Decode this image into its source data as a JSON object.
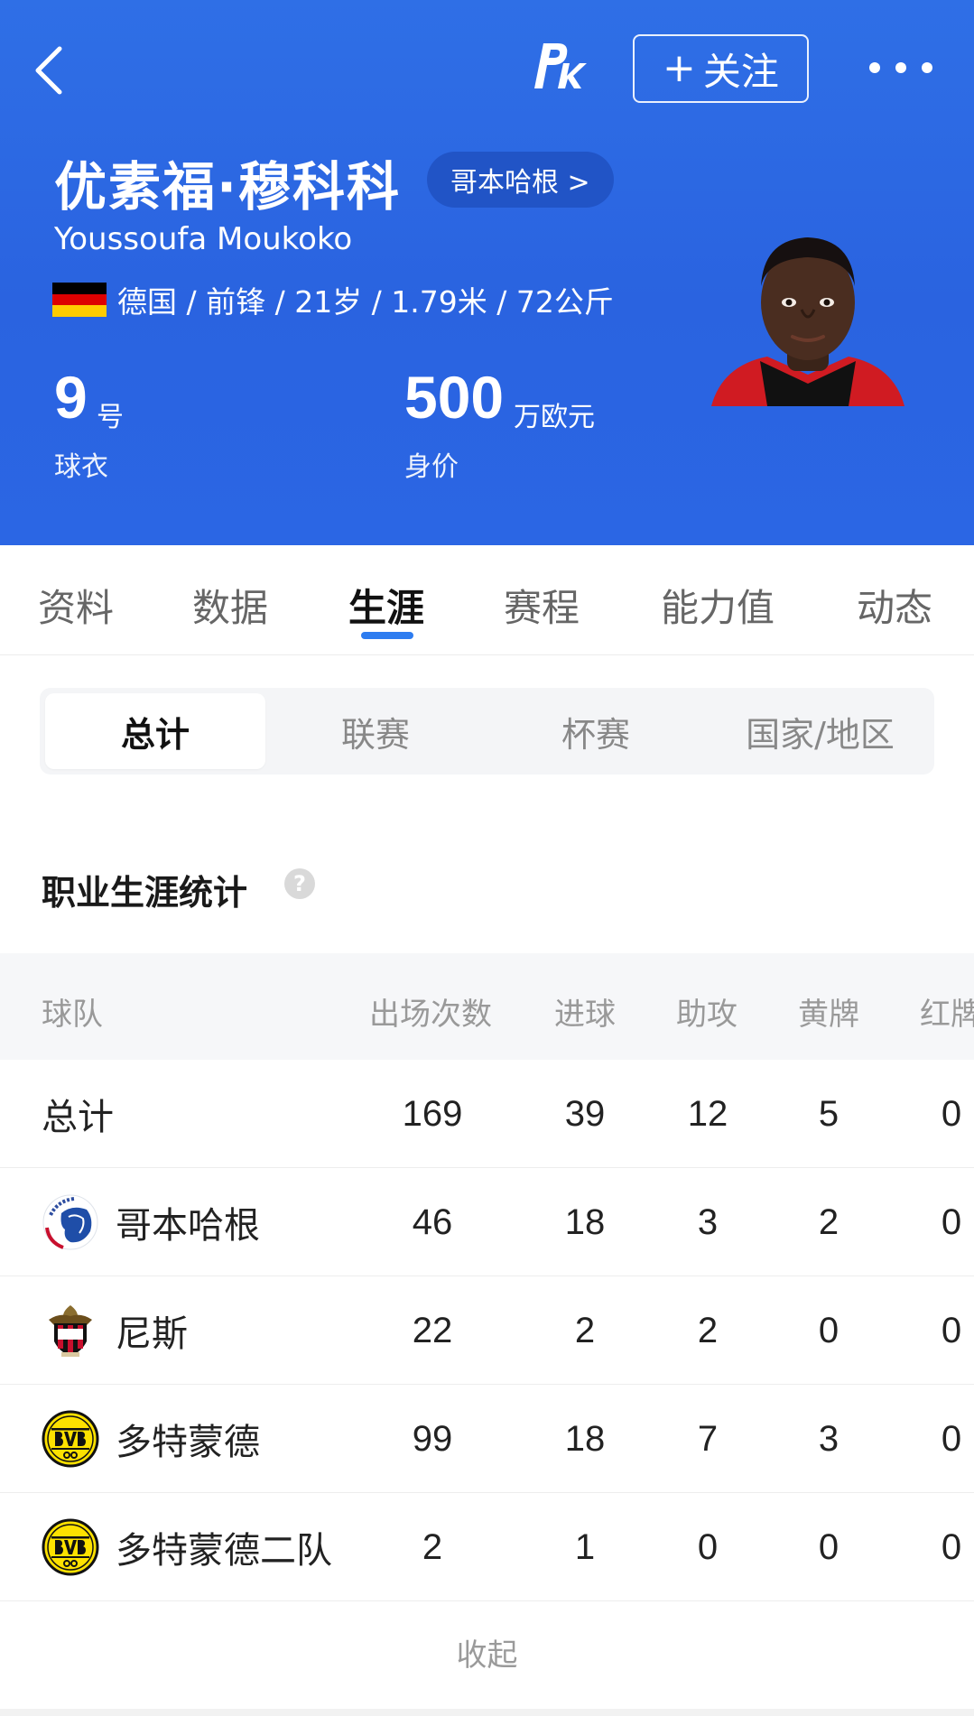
{
  "header": {
    "follow_label": "关注",
    "follow_plus": "+",
    "logo_text": "PK",
    "name_cn": "优素福·穆科科",
    "club_pill": "哥本哈根 >",
    "name_en": "Youssoufa Moukoko",
    "info_line": "德国 / 前锋 / 21岁 / 1.79米 / 72公斤",
    "flag_colors": [
      "#000000",
      "#dd0000",
      "#ffcc00"
    ],
    "jersey": {
      "value": "9",
      "unit": "号",
      "label": "球衣"
    },
    "market_value": {
      "value": "500",
      "unit": "万欧元",
      "label": "身价"
    },
    "colors": {
      "background": "#2a63e0",
      "pill": "#2154c6"
    }
  },
  "tabs": {
    "items": [
      "资料",
      "数据",
      "生涯",
      "赛程",
      "能力值",
      "动态"
    ],
    "active": "生涯",
    "accent": "#2d7cf0"
  },
  "segmented": {
    "items": [
      "总计",
      "联赛",
      "杯赛",
      "国家/地区"
    ],
    "active": "总计"
  },
  "section": {
    "title": "职业生涯统计",
    "help_glyph": "?"
  },
  "table": {
    "headers": [
      "球队",
      "出场次数",
      "进球",
      "助攻",
      "黄牌",
      "红牌"
    ],
    "rows": [
      {
        "team": "总计",
        "logo": "",
        "cells": [
          "169",
          "39",
          "12",
          "5",
          "0"
        ]
      },
      {
        "team": "哥本哈根",
        "logo": "fc-copenhagen-crest-icon",
        "cells": [
          "46",
          "18",
          "3",
          "2",
          "0"
        ]
      },
      {
        "team": "尼斯",
        "logo": "ogc-nice-crest-icon",
        "cells": [
          "22",
          "2",
          "2",
          "0",
          "0"
        ]
      },
      {
        "team": "多特蒙德",
        "logo": "bvb-crest-icon",
        "cells": [
          "99",
          "18",
          "7",
          "3",
          "0"
        ]
      },
      {
        "team": "多特蒙德二队",
        "logo": "bvb-crest-icon",
        "cells": [
          "2",
          "1",
          "0",
          "0",
          "0"
        ]
      }
    ]
  },
  "footer": {
    "collapse_label": "收起"
  }
}
